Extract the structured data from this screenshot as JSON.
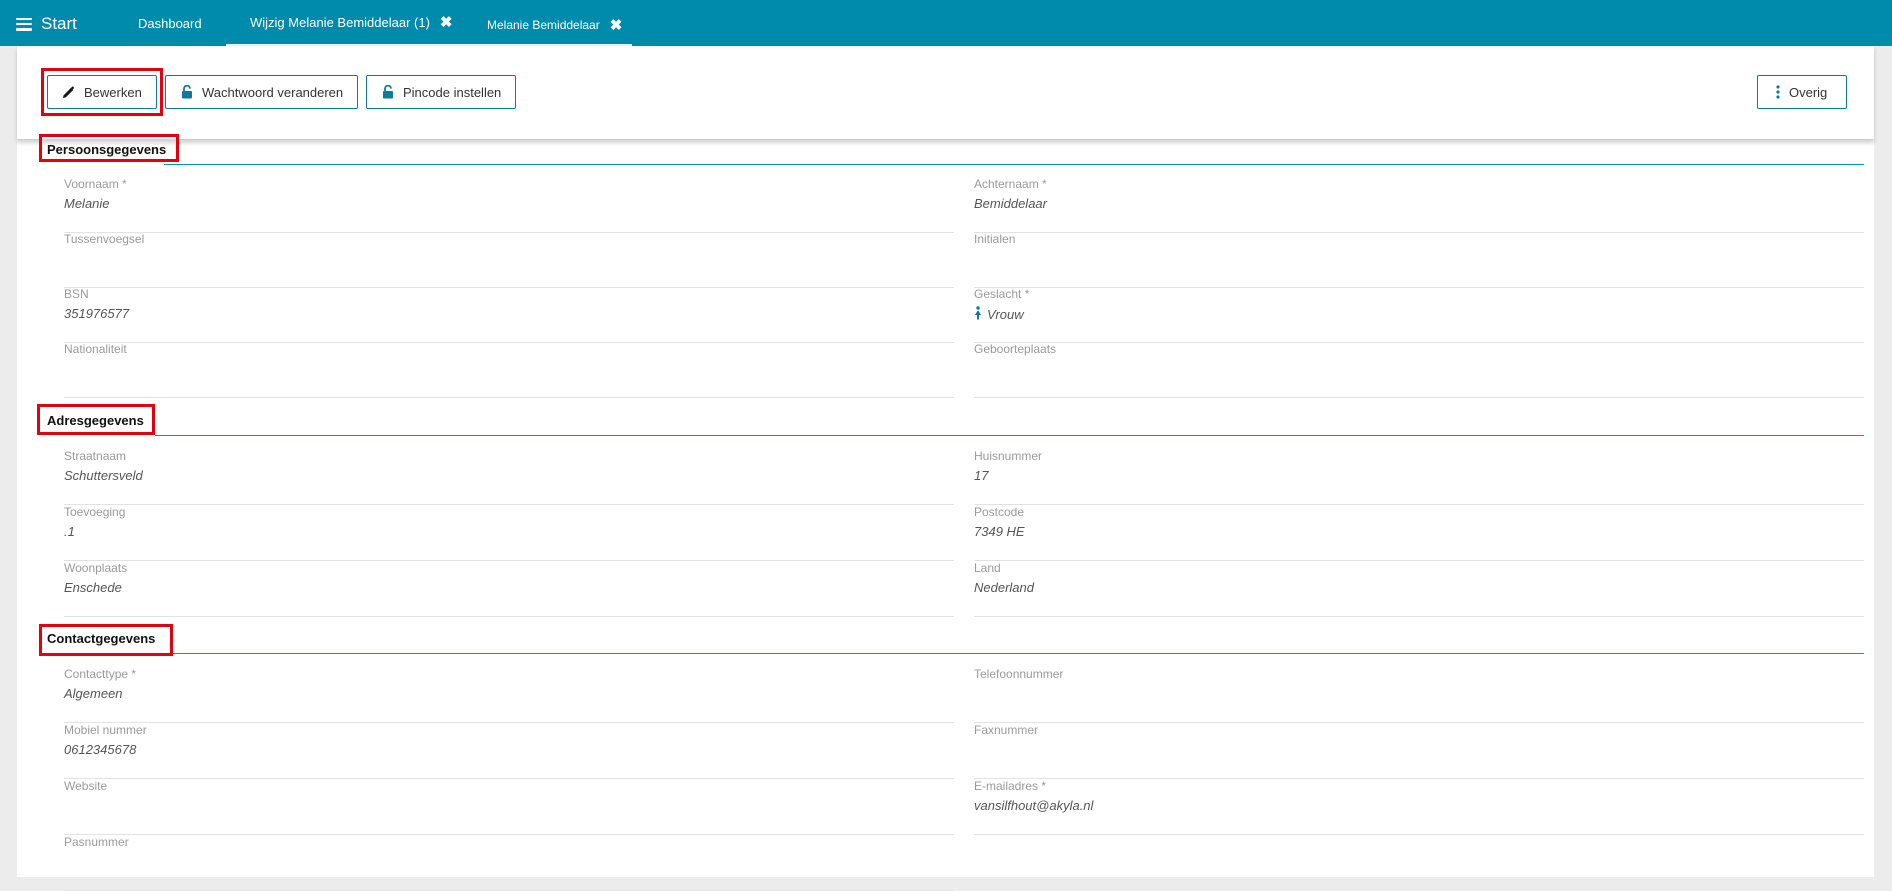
{
  "header": {
    "start_label": "Start",
    "tabs": [
      {
        "label": "Dashboard",
        "closable": false
      },
      {
        "label": "Wijzig Melanie Bemiddelaar (1)",
        "closable": true
      },
      {
        "label": "Melanie Bemiddelaar",
        "closable": true,
        "active": true
      }
    ],
    "close_glyph": "✖"
  },
  "toolbar": {
    "edit_label": "Bewerken",
    "password_label": "Wachtwoord veranderen",
    "pincode_label": "Pincode instellen",
    "more_label": "Overig"
  },
  "sections": {
    "personal": {
      "title": "Persoonsgegevens",
      "fields": {
        "voornaam": {
          "label": "Voornaam *",
          "value": "Melanie"
        },
        "achternaam": {
          "label": "Achternaam *",
          "value": "Bemiddelaar"
        },
        "tussenvoegsel": {
          "label": "Tussenvoegsel",
          "value": ""
        },
        "initialen": {
          "label": "Initialen",
          "value": ""
        },
        "bsn": {
          "label": "BSN",
          "value": "351976577"
        },
        "geslacht": {
          "label": "Geslacht *",
          "value": "Vrouw",
          "icon": "female-icon"
        },
        "nationaliteit": {
          "label": "Nationaliteit",
          "value": ""
        },
        "geboorteplaats": {
          "label": "Geboorteplaats",
          "value": ""
        }
      }
    },
    "address": {
      "title": "Adresgegevens",
      "fields": {
        "straatnaam": {
          "label": "Straatnaam",
          "value": "Schuttersveld"
        },
        "huisnummer": {
          "label": "Huisnummer",
          "value": "17"
        },
        "toevoeging": {
          "label": "Toevoeging",
          "value": ".1"
        },
        "postcode": {
          "label": "Postcode",
          "value": "7349 HE"
        },
        "woonplaats": {
          "label": "Woonplaats",
          "value": "Enschede"
        },
        "land": {
          "label": "Land",
          "value": "Nederland"
        }
      }
    },
    "contact": {
      "title": "Contactgegevens",
      "fields": {
        "contacttype": {
          "label": "Contacttype *",
          "value": "Algemeen"
        },
        "telefoonnummer": {
          "label": "Telefoonnummer",
          "value": ""
        },
        "mobiel": {
          "label": "Mobiel nummer",
          "value": "0612345678"
        },
        "faxnummer": {
          "label": "Faxnummer",
          "value": ""
        },
        "website": {
          "label": "Website",
          "value": ""
        },
        "email": {
          "label": "E-mailadres *",
          "value": "vansilfhout@akyla.nl"
        },
        "pasnummer": {
          "label": "Pasnummer",
          "value": ""
        }
      }
    }
  },
  "colors": {
    "header_bg": "#008aab",
    "accent": "#009ab8",
    "highlight": "#e3000f"
  }
}
